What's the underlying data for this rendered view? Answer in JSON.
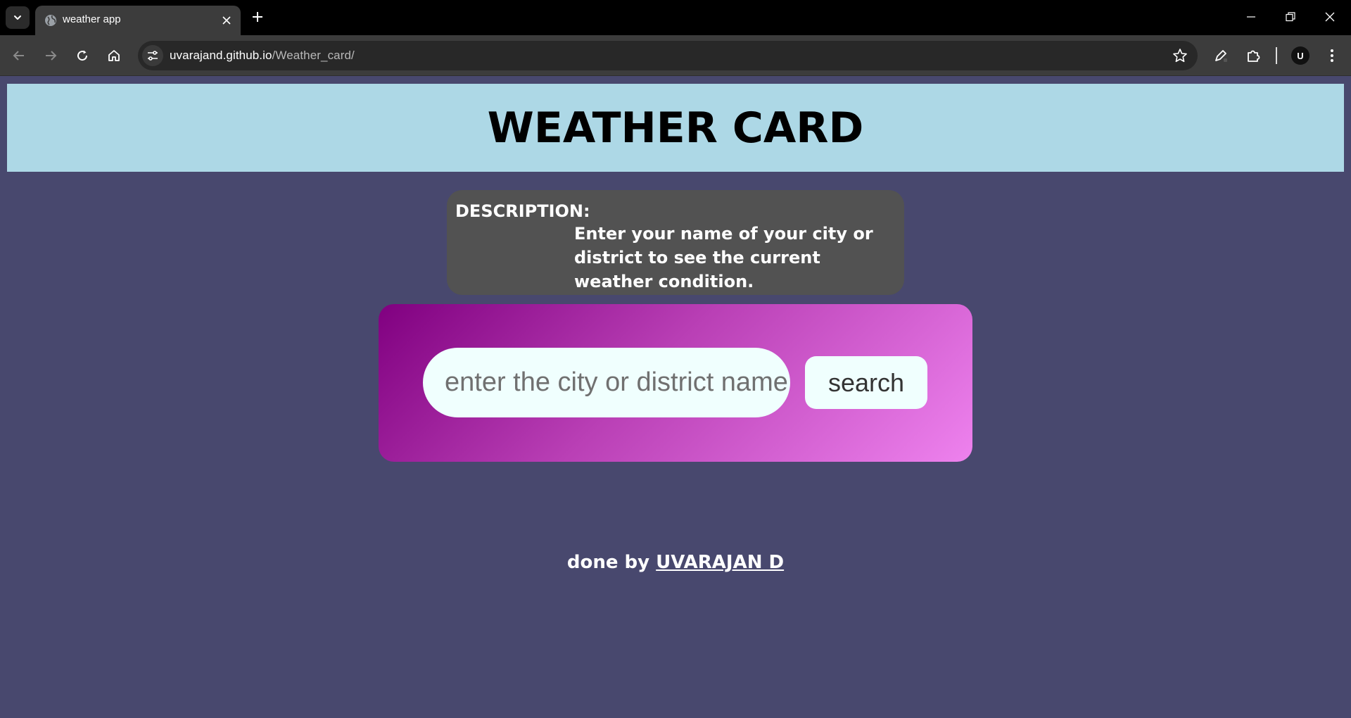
{
  "browser": {
    "tab_title": "weather app",
    "url_host": "uvarajand.github.io",
    "url_path": "/Weather_card/",
    "profile_initial": "U"
  },
  "icons": {
    "tab_dropdown": "chevron-down-icon",
    "tab_favicon": "globe-icon",
    "tab_close": "close-icon",
    "new_tab": "plus-icon",
    "back": "arrow-left-icon",
    "forward": "arrow-right-icon",
    "reload": "reload-icon",
    "home": "home-icon",
    "site_info": "tune-icon",
    "bookmark": "star-icon",
    "edit": "pen-icon",
    "extensions": "puzzle-icon",
    "menu": "kebab-menu-icon"
  },
  "header": {
    "title": "WEATHER CARD"
  },
  "description": {
    "label": "DESCRIPTION:",
    "text": "Enter your name of your city or district to see the current weather condition."
  },
  "search": {
    "placeholder": "enter the city or district name",
    "button_label": "search"
  },
  "footer": {
    "prefix": "done by ",
    "author": "UVARAJAN D"
  },
  "colors": {
    "page_bg": "#48486e",
    "header_bg": "#add8e6",
    "description_bg": "#525252",
    "card_gradient_start": "#800080",
    "card_gradient_end": "#ee82ee",
    "input_bg": "#f0fffe"
  }
}
